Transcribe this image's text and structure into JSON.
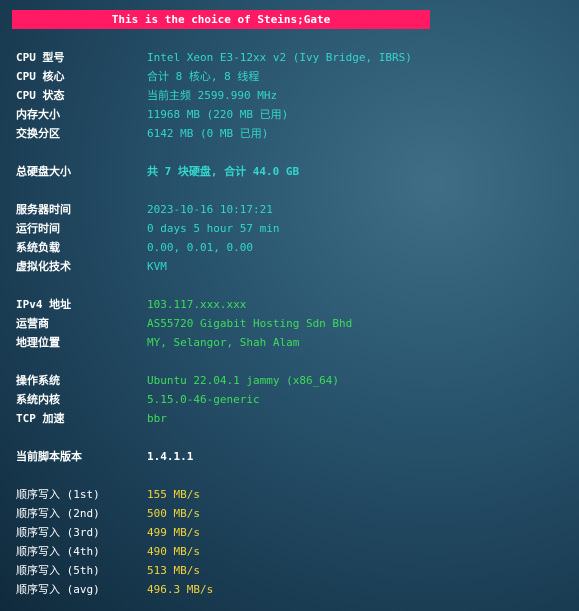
{
  "banner": "This is the choice of Steins;Gate",
  "system": {
    "cpu_model_label": "CPU 型号",
    "cpu_model": "Intel Xeon E3-12xx v2 (Ivy Bridge, IBRS)",
    "cpu_cores_label": "CPU 核心",
    "cpu_cores": "合计 8 核心, 8 线程",
    "cpu_status_label": "CPU 状态",
    "cpu_status": "当前主频 2599.990 MHz",
    "memory_label": "内存大小",
    "memory": "11968 MB (220 MB 已用)",
    "swap_label": "交换分区",
    "swap": "6142 MB (0 MB 已用)"
  },
  "disk": {
    "total_label": "总硬盘大小",
    "total": "共 7 块硬盘, 合计 44.0 GB"
  },
  "runtime": {
    "server_time_label": "服务器时间",
    "server_time": "2023-10-16 10:17:21",
    "uptime_label": "运行时间",
    "uptime": "0 days 5 hour 57 min",
    "load_label": "系统负载",
    "load": "0.00, 0.01, 0.00",
    "virt_label": "虚拟化技术",
    "virt": "KVM"
  },
  "network": {
    "ipv4_label": "IPv4 地址",
    "ipv4": "103.117.xxx.xxx",
    "isp_label": "运营商",
    "isp": "AS55720 Gigabit Hosting Sdn Bhd",
    "location_label": "地理位置",
    "location": "MY, Selangor, Shah Alam"
  },
  "os": {
    "os_label": "操作系统",
    "os": "Ubuntu 22.04.1 jammy (x86_64)",
    "kernel_label": "系统内核",
    "kernel": "5.15.0-46-generic",
    "tcp_label": "TCP 加速",
    "tcp": "bbr"
  },
  "script": {
    "version_label": "当前脚本版本",
    "version": "1.4.1.1"
  },
  "io_tests": [
    {
      "label": "顺序写入 (1st)",
      "value": "155 MB/s"
    },
    {
      "label": "顺序写入 (2nd)",
      "value": "500 MB/s"
    },
    {
      "label": "顺序写入 (3rd)",
      "value": "499 MB/s"
    },
    {
      "label": "顺序写入 (4th)",
      "value": "490 MB/s"
    },
    {
      "label": "顺序写入 (5th)",
      "value": "513 MB/s"
    },
    {
      "label": "顺序写入 (avg)",
      "value": "496.3 MB/s"
    }
  ],
  "colors": {
    "banner_bg": "#ff1a63",
    "cyan_value": "#33d6cc",
    "green_value": "#3ddc5a",
    "yellow_value": "#f2d43a"
  }
}
